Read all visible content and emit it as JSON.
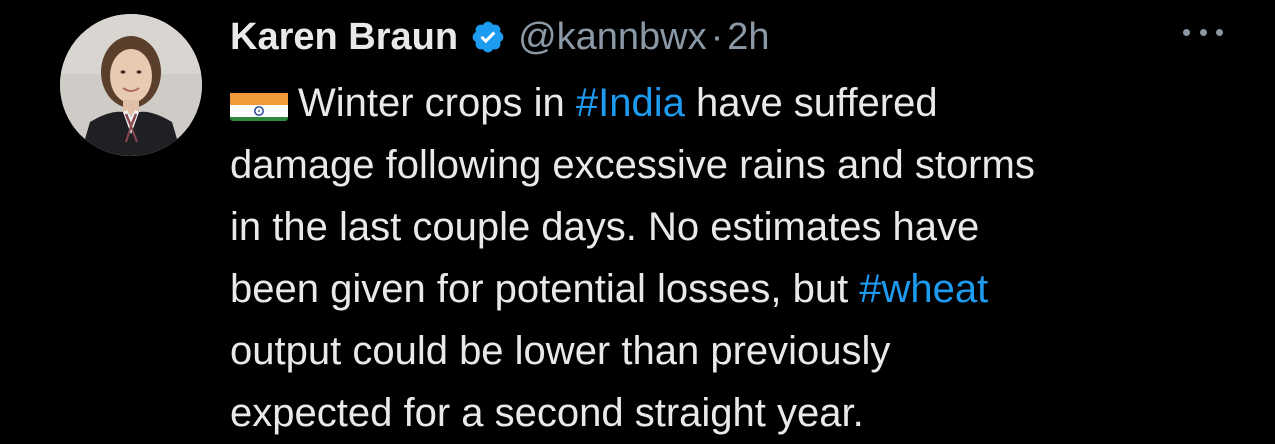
{
  "author": {
    "name": "Karen Braun",
    "handle": "@kannbwx",
    "separator": "·",
    "time": "2h",
    "verified": true
  },
  "colors": {
    "background": "#000000",
    "text": "#e7e9ea",
    "secondary": "#8b98a5",
    "accent": "#1d9bf0"
  },
  "icons": {
    "verified": "verified-badge-icon",
    "more": "more-options-icon",
    "flag": "india-flag-icon"
  },
  "tweet": {
    "lines": [
      [
        "Winter crops in ",
        "#India",
        " have suffered"
      ],
      [
        "damage following excessive rains and storms"
      ],
      [
        "in the last couple days. No estimates have"
      ],
      [
        "been given for potential losses, but ",
        "#wheat"
      ],
      [
        "output could be lower than previously"
      ],
      [
        "expected for a second straight year."
      ]
    ]
  }
}
